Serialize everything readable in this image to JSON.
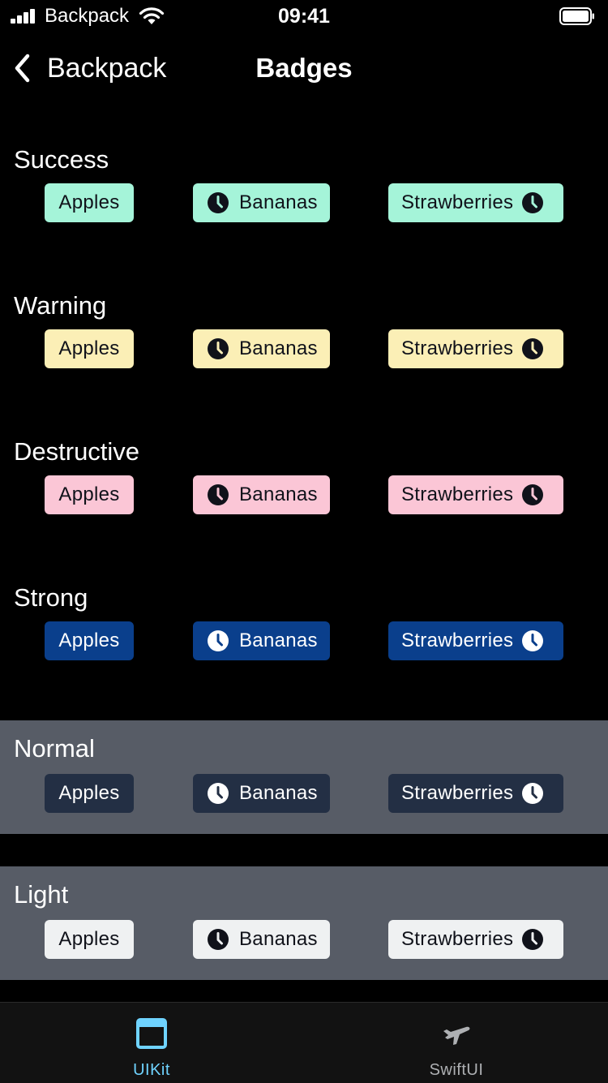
{
  "status_bar": {
    "carrier": "Backpack",
    "time": "09:41",
    "signal_icon": "signal-bars-icon",
    "wifi_icon": "wifi-icon",
    "battery_icon": "battery-icon"
  },
  "nav": {
    "back_label": "Backpack",
    "back_icon": "chevron-left-icon",
    "title": "Badges"
  },
  "badge_labels": {
    "first": "Apples",
    "second": "Bananas",
    "third": "Strawberries"
  },
  "sections": [
    {
      "title": "Success",
      "badge_bg": "#a5f4d9",
      "badge_text": "#10121a",
      "panel_bg": "#000000"
    },
    {
      "title": "Warning",
      "badge_bg": "#fbefb6",
      "badge_text": "#10121a",
      "panel_bg": "#000000"
    },
    {
      "title": "Destructive",
      "badge_bg": "#fbc6d6",
      "badge_text": "#10121a",
      "panel_bg": "#000000"
    },
    {
      "title": "Strong",
      "badge_bg": "#0a3f8c",
      "badge_text": "#ffffff",
      "panel_bg": "#000000"
    },
    {
      "title": "Normal",
      "badge_bg": "#232f44",
      "badge_text": "#ffffff",
      "panel_bg": "#575c66"
    },
    {
      "title": "Light",
      "badge_bg": "#eff1f2",
      "badge_text": "#10121a",
      "panel_bg": "#575c66"
    }
  ],
  "tab_bar": {
    "tabs": [
      {
        "label": "UIKit",
        "icon": "window-icon",
        "selected": true,
        "color": "#6fd3ff"
      },
      {
        "label": "SwiftUI",
        "icon": "airplane-icon",
        "selected": false,
        "color": "#aeb0b3"
      }
    ]
  }
}
